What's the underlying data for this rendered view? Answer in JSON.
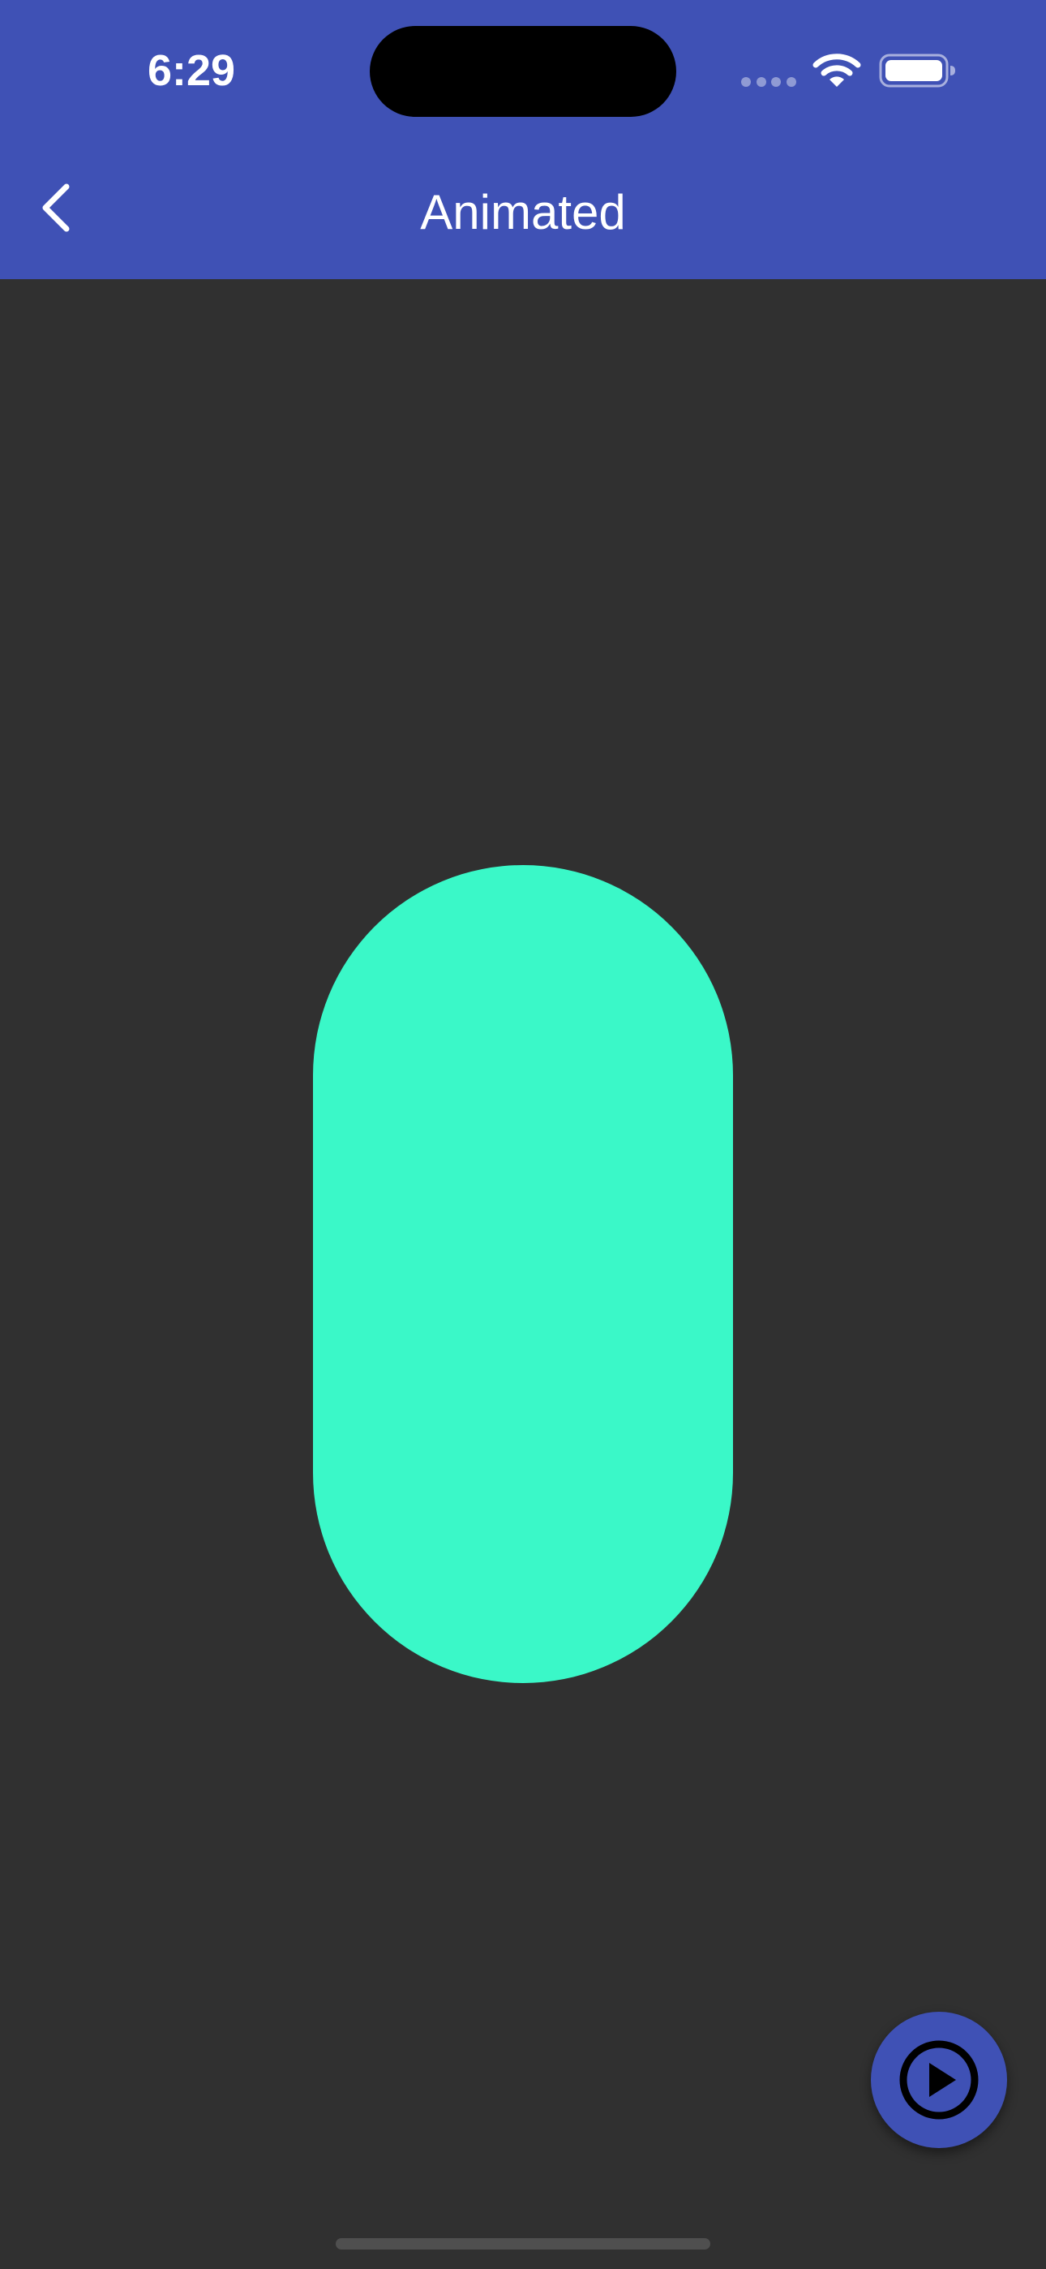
{
  "status_bar": {
    "time": "6:29",
    "icons": [
      "cellular-signal-icon",
      "wifi-icon",
      "battery-icon"
    ]
  },
  "app_bar": {
    "title": "Animated",
    "back_icon": "chevron-left-icon"
  },
  "content": {
    "shape": "rounded-pill"
  },
  "fab": {
    "icon": "play-circle-icon"
  },
  "colors": {
    "app_bar": "#3F51B5",
    "background": "#303030",
    "shape": "#3AF8C8",
    "fab": "#3F51B5",
    "fab_icon": "#000000",
    "text": "#FFFFFF"
  }
}
